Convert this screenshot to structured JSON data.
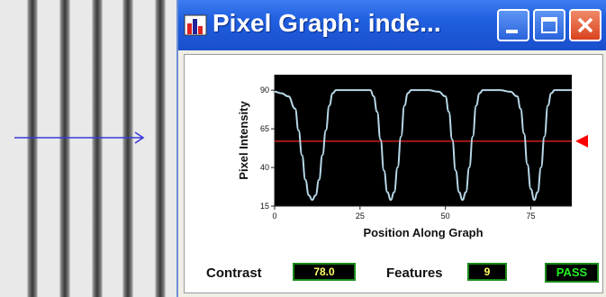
{
  "window": {
    "title": "Pixel Graph: inde...",
    "app_icon": "bar-chart-icon",
    "controls": [
      "minimize-icon",
      "maximize-icon",
      "close-icon"
    ]
  },
  "camera_image": {
    "stripe_count": 5,
    "scan_arrow_icon": "arrow-right-icon",
    "scan_arrow_color": "#3b3bd9"
  },
  "chart_data": {
    "type": "line",
    "xlabel": "Position Along Graph",
    "ylabel": "Pixel Intensity",
    "x_ticks": [
      "0",
      "25",
      "50",
      "75"
    ],
    "y_ticks": [
      "15",
      "40",
      "65",
      "90"
    ],
    "xlim": [
      0,
      87
    ],
    "ylim": [
      15,
      100
    ],
    "threshold": 57,
    "threshold_color": "#a01818",
    "threshold_marker_color": "#ff0000",
    "line_color": "#b8d8e8",
    "background": "#000000",
    "series": [
      {
        "x": [
          0,
          2,
          4,
          6,
          7,
          8,
          9,
          10,
          11,
          12,
          13,
          14,
          15,
          16,
          17,
          18,
          20,
          24,
          28,
          29,
          30,
          31,
          32,
          33,
          34,
          35,
          36,
          37,
          38,
          39,
          40,
          42,
          45,
          48,
          50,
          51,
          52,
          53,
          54,
          55,
          56,
          57,
          58,
          59,
          60,
          61,
          63,
          66,
          69,
          71,
          72,
          73,
          74,
          75,
          76,
          77,
          78,
          79,
          80,
          81,
          82,
          84,
          87
        ],
        "values": [
          89,
          88,
          86,
          78,
          64,
          48,
          32,
          22,
          19,
          22,
          32,
          48,
          64,
          80,
          88,
          90,
          90,
          90,
          90,
          86,
          76,
          58,
          38,
          24,
          19,
          24,
          40,
          60,
          80,
          88,
          90,
          90,
          90,
          89,
          86,
          76,
          58,
          38,
          24,
          19,
          24,
          40,
          60,
          80,
          88,
          90,
          90,
          90,
          89,
          86,
          78,
          62,
          42,
          26,
          19,
          24,
          40,
          60,
          80,
          88,
          90,
          90,
          90
        ]
      }
    ]
  },
  "status": {
    "contrast_label": "Contrast",
    "contrast_value": "78.0",
    "features_label": "Features",
    "features_value": "9",
    "result": "PASS",
    "result_color": "#22ee22"
  }
}
